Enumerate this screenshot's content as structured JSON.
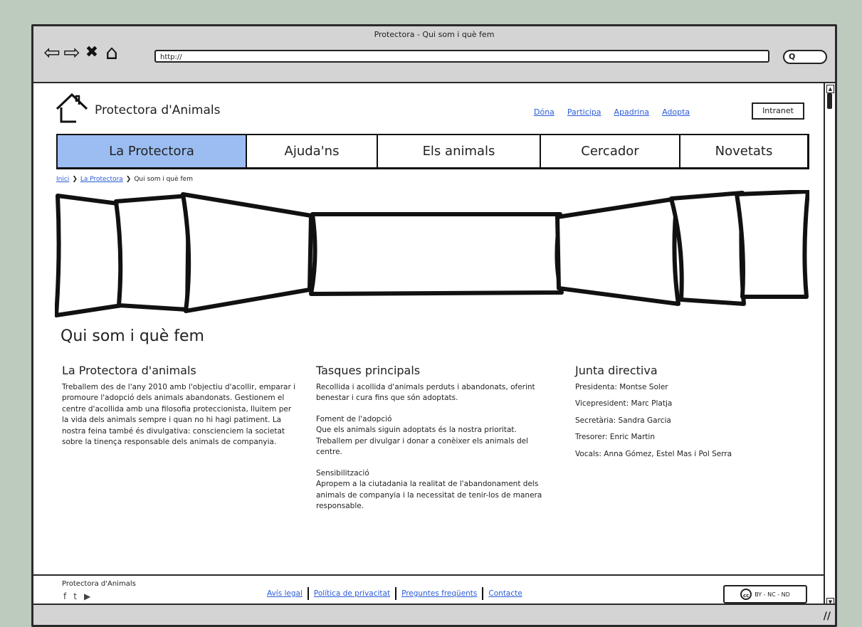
{
  "window": {
    "title": "Protectora - Qui som i què fem",
    "url": "http://"
  },
  "header": {
    "logo_text": "Protectora d'Animals",
    "links": [
      "Dóna",
      "Participa",
      "Apadrina",
      "Adopta"
    ],
    "intranet": "Intranet"
  },
  "menu": [
    {
      "label": "La Protectora",
      "active": true
    },
    {
      "label": "Ajuda'ns",
      "active": false
    },
    {
      "label": "Els animals",
      "active": false
    },
    {
      "label": "Cercador",
      "active": false
    },
    {
      "label": "Novetats",
      "active": false
    }
  ],
  "breadcrumb": {
    "home": "Inici",
    "section": "La Protectora",
    "current": "Qui som i què fem"
  },
  "page_title": "Qui som i què fem",
  "col1": {
    "heading": "La Protectora d'animals",
    "text": "Treballem des de l'any 2010 amb l'objectiu d'acollir, emparar i promoure l'adopció dels animals abandonats. Gestionem el centre d'acollida amb una filosofia proteccionista, lluitem per la vida dels animals sempre i quan no hi hagi patiment. La nostra feina també és divulgativa: conscienciem la societat sobre la tinença responsable dels animals de companyia."
  },
  "col2": {
    "heading": "Tasques principals",
    "p1": "Recollida i acollida d'animals perduts i abandonats, oferint benestar i cura fins que són adoptats.",
    "p2_title": "Foment de l'adopció",
    "p2_text": "Que els animals siguin adoptats és la nostra prioritat. Treballem per divulgar i donar a conèixer els animals del centre.",
    "p3_title": "Sensibilització",
    "p3_text": "Apropem a la ciutadania la realitat de l'abandonament dels animals de companyia i la necessitat de tenir-los de manera responsable."
  },
  "col3": {
    "heading": "Junta directiva",
    "members": [
      "Presidenta: Montse Soler",
      "Vicepresident: Marc Platja",
      "Secretària: Sandra Garcia",
      "Tresorer: Enric Martin",
      "Vocals: Anna Gómez, Estel Mas i Pol Serra"
    ]
  },
  "footer": {
    "brand": "Protectora d'Animals",
    "links": [
      "Avís legal",
      "Política de privacitat",
      "Preguntes freqüents",
      "Contacte"
    ],
    "license_icon": "cc",
    "license": "BY - NC - ND"
  }
}
